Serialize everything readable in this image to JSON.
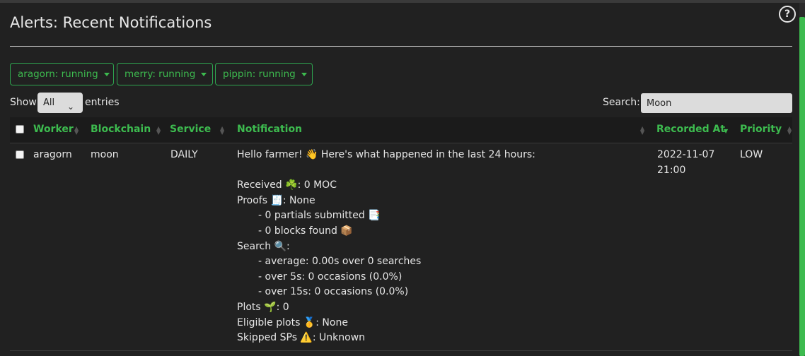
{
  "title": "Alerts: Recent Notifications",
  "workers": [
    {
      "label": "aragorn: running"
    },
    {
      "label": "merry: running"
    },
    {
      "label": "pippin: running"
    }
  ],
  "table_controls": {
    "show_label": "Show",
    "page_size": "All",
    "entries_label": "entries",
    "search_label": "Search:",
    "search_value": "Moon"
  },
  "columns": [
    "Worker",
    "Blockchain",
    "Service",
    "Notification",
    "Recorded At",
    "Priority"
  ],
  "sorted_column": "Recorded At",
  "rows": [
    {
      "worker": "aragorn",
      "blockchain": "moon",
      "service": "DAILY",
      "recorded_at_date": "2022-11-07",
      "recorded_at_time": "21:00",
      "priority": "LOW",
      "notification_lines": [
        "Hello farmer! 👋 Here's what happened in the last 24 hours:",
        "",
        "Received ☘️: 0 MOC",
        "Proofs 🧾: None",
        "- 0 partials submitted 📑",
        "- 0 blocks found 📦",
        "Search 🔍:",
        "- average: 0.00s over 0 searches",
        "- over 5s: 0 occasions (0.0%)",
        "- over 15s: 0 occasions (0.0%)",
        "Plots 🌱: 0",
        "Eligible plots 🥇: None",
        "Skipped SPs ⚠️: Unknown"
      ]
    }
  ],
  "colors": {
    "accent": "#3dbb4f",
    "background": "#212121",
    "header_bg": "#1b1b1b"
  },
  "icons": {
    "help": "question-circle-icon",
    "dropdown": "caret-down-icon",
    "sort": "sort-icon"
  }
}
